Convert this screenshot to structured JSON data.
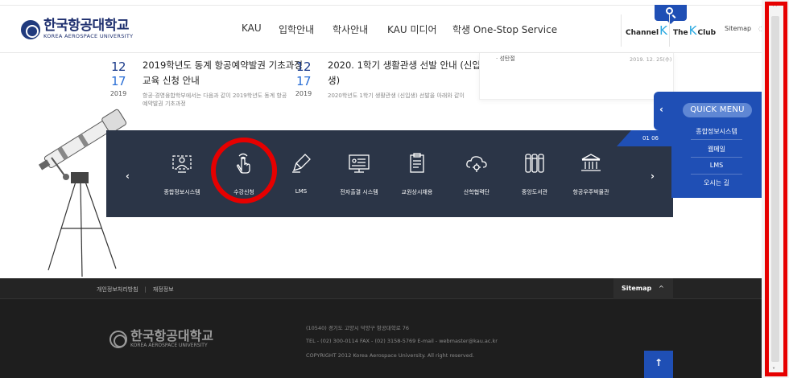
{
  "header": {
    "logo_ko": "한국항공대학교",
    "logo_en": "KOREA AEROSPACE UNIVERSITY",
    "nav": [
      "KAU",
      "입학안내",
      "학사안내",
      "KAU 미디어",
      "학생 One-Stop Service"
    ],
    "channel_k": {
      "pre": "Channel",
      "k": "K"
    },
    "the_k_club": {
      "pre": "The",
      "k": "K",
      "post": "Club"
    },
    "sitemap": "Sitemap"
  },
  "notices": [
    {
      "month_day_a": "12",
      "month_day_b": "17",
      "year": "2019",
      "title": "2019학년도 동계 항공예약발권 기초과정 교육 신청 안내",
      "desc": "항공·경영융합학부에서는 다음과 같이 2019학년도 동계 항공예약발권 기초과정"
    },
    {
      "month_day_a": "12",
      "month_day_b": "17",
      "year": "2019",
      "title": "2020. 1학기 생활관생 선발 안내 (신입생)",
      "desc": "2020학년도 1학기 생활관생 (신입생) 선발을 아래와 같이"
    }
  ],
  "side_notice": {
    "item": "· 성탄절",
    "date": "2019. 12. 25(수)"
  },
  "quickbar": {
    "page": "01 06",
    "prev": "‹",
    "next": "›",
    "items": [
      {
        "label": "종합정보시스템",
        "icon": "person-screen-icon"
      },
      {
        "label": "수강신청",
        "icon": "hand-pointer-icon"
      },
      {
        "label": "LMS",
        "icon": "pen-icon"
      },
      {
        "label": "전자출결 시스템",
        "icon": "attendance-board-icon"
      },
      {
        "label": "교원상시채용",
        "icon": "clipboard-icon"
      },
      {
        "label": "산학협력단",
        "icon": "cloud-gear-icon"
      },
      {
        "label": "중앙도서관",
        "icon": "books-icon"
      },
      {
        "label": "항공우주박물관",
        "icon": "museum-icon"
      }
    ]
  },
  "quickmenu": {
    "tab": "‹",
    "title": "QUICK MENU",
    "items": [
      "종합정보시스템",
      "웹메일",
      "LMS",
      "오시는 길"
    ]
  },
  "footer": {
    "links": [
      "개인정보처리방침",
      "|",
      "재정정보"
    ],
    "sitemap": "Sitemap",
    "sitemap_caret": "^",
    "logo_ko": "한국항공대학교",
    "logo_en": "KOREA AEROSPACE UNIVERSITY",
    "address": "(10540) 경기도 고양시 덕양구 항공대학로 76",
    "contact": "TEL - (02) 300-0114  FAX - (02) 3158-5769 E-mail - webmaster@kau.ac.kr",
    "copyright": "COPYRIGHT 2012 Korea Aerospace University. All right reserved.",
    "top_button": "↑"
  },
  "scrollbar": {
    "up": "^",
    "down": "˅"
  },
  "colors": {
    "brand_blue": "#1f4fb5",
    "navy": "#1e2f6e",
    "quickbar_bg": "#2b3547",
    "highlight_red": "#e60000",
    "footer_bg": "#1e1e1e"
  }
}
